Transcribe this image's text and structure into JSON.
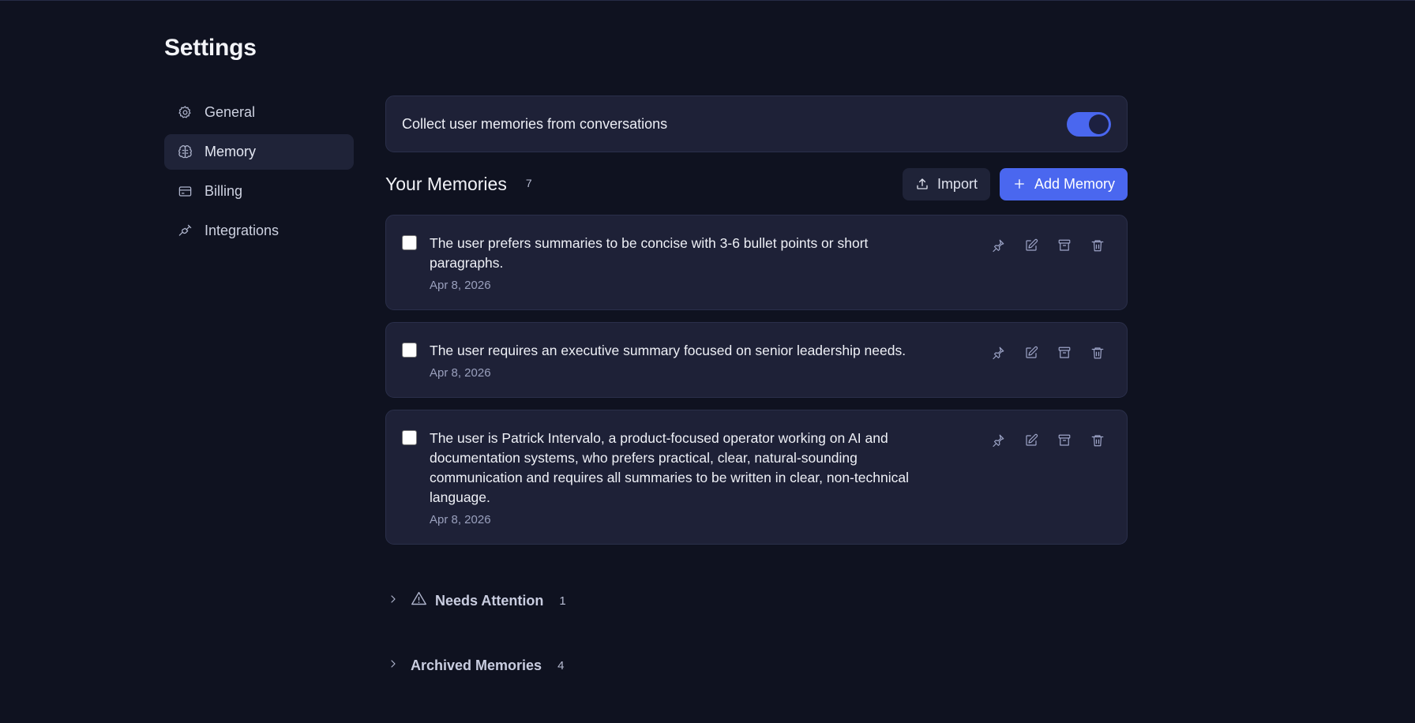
{
  "page": {
    "title": "Settings"
  },
  "sidebar": {
    "items": [
      {
        "label": "General",
        "icon": "gear-icon",
        "active": false
      },
      {
        "label": "Memory",
        "icon": "brain-icon",
        "active": true
      },
      {
        "label": "Billing",
        "icon": "credit-card-icon",
        "active": false
      },
      {
        "label": "Integrations",
        "icon": "plug-icon",
        "active": false
      }
    ]
  },
  "memory_toggle": {
    "label": "Collect user memories from conversations",
    "enabled": true
  },
  "memories": {
    "title": "Your Memories",
    "count": "7",
    "import_label": "Import",
    "add_label": "Add Memory",
    "items": [
      {
        "text": "The user prefers summaries to be concise with 3-6 bullet points or short paragraphs.",
        "date": "Apr 8, 2026",
        "checked": false
      },
      {
        "text": "The user requires an executive summary focused on senior leadership needs.",
        "date": "Apr 8, 2026",
        "checked": false
      },
      {
        "text": "The user is Patrick Intervalo, a product-focused operator working on AI and documentation systems, who prefers practical, clear, natural-sounding communication and requires all summaries to be written in clear, non-technical language.",
        "date": "Apr 8, 2026",
        "checked": false
      }
    ]
  },
  "needs_attention": {
    "label": "Needs Attention",
    "count": "1"
  },
  "archived": {
    "label": "Archived Memories",
    "count": "4"
  },
  "colors": {
    "background": "#0f1220",
    "card": "#1e2137",
    "accent": "#4a67ef"
  }
}
